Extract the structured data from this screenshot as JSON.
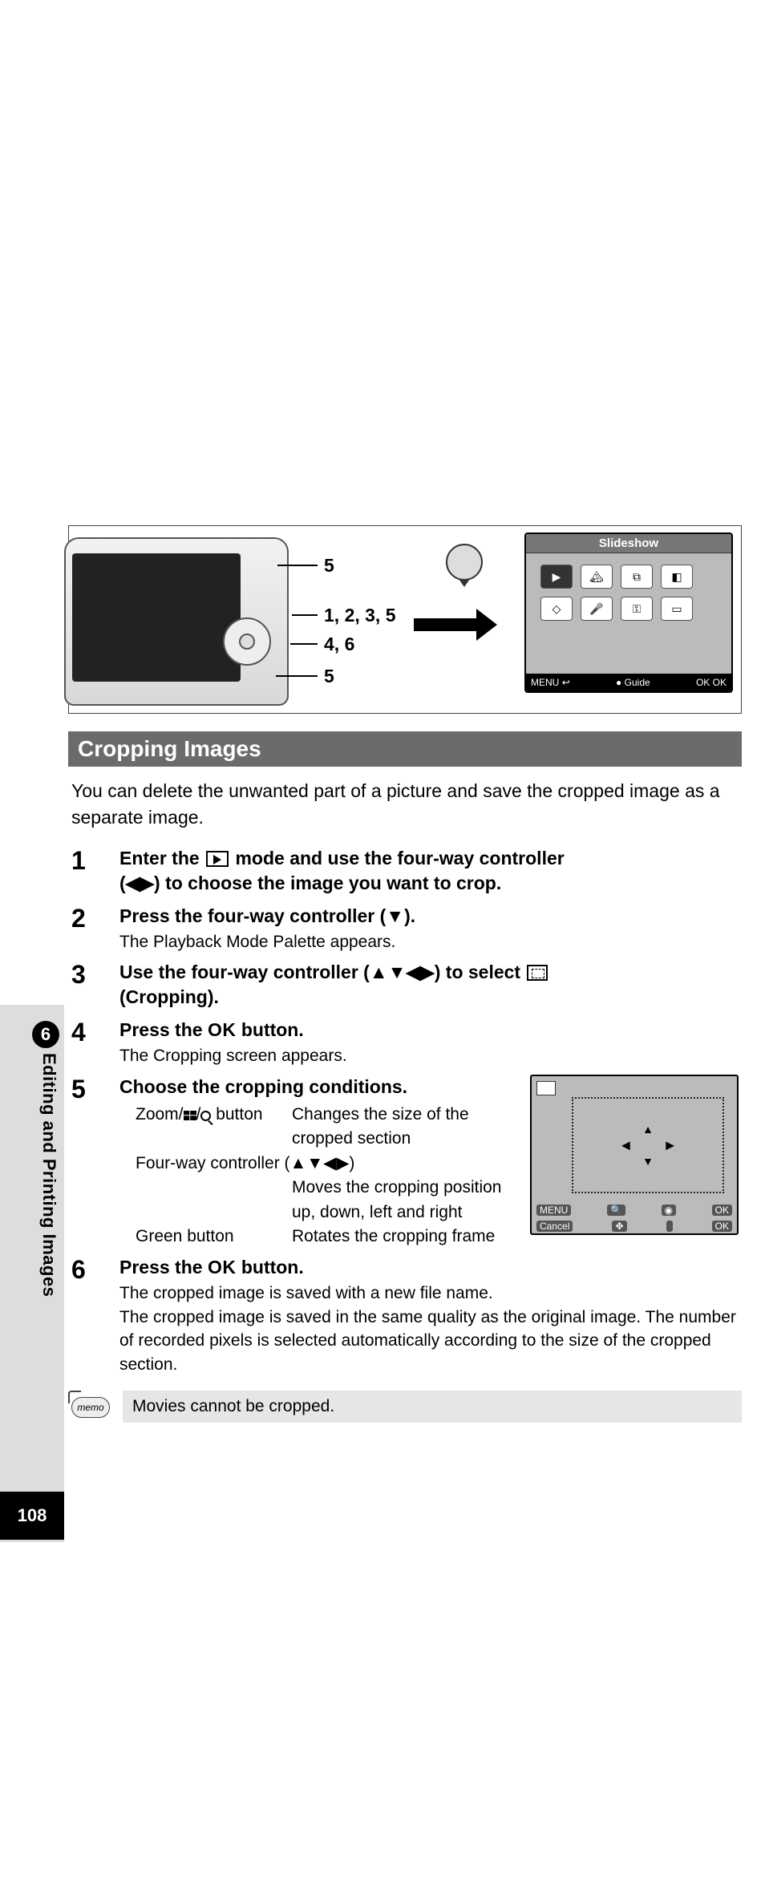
{
  "page_number": "108",
  "side_tab": {
    "chapter": "6",
    "title": "Editing and Printing Images"
  },
  "diagram": {
    "pointers": {
      "a": "5",
      "b": "1, 2, 3, 5",
      "c": "4, 6",
      "d": "5"
    },
    "lcd_title": "Slideshow",
    "lcd_footer": {
      "menu": "MENU",
      "menu_icon": "↩",
      "guide_icon": "●",
      "guide": "Guide",
      "ok": "OK",
      "ok2": "OK"
    }
  },
  "section_title": "Cropping Images",
  "intro": "You can delete the unwanted part of a picture and save the cropped image as a separate image.",
  "steps": {
    "s1": {
      "num": "1",
      "line1_a": "Enter the ",
      "line1_b": " mode and use the four-way controller",
      "line2": "(◀▶) to choose the image you want to crop."
    },
    "s2": {
      "num": "2",
      "head": "Press the four-way controller (▼).",
      "desc": "The Playback Mode Palette appears."
    },
    "s3": {
      "num": "3",
      "head_a": "Use the four-way controller (▲▼◀▶) to select ",
      "head_b": "(Cropping)."
    },
    "s4": {
      "num": "4",
      "head_a": "Press the ",
      "head_ok": "OK",
      "head_b": " button.",
      "desc": "The Cropping screen appears."
    },
    "s5": {
      "num": "5",
      "head": "Choose the cropping conditions.",
      "rows": {
        "r1_lbl_a": "Zoom/",
        "r1_lbl_b": "/",
        "r1_lbl_c": " button",
        "r1_val": "Changes the size of the cropped section",
        "r2_lbl": "Four-way controller (▲▼◀▶)",
        "r2_val": "Moves the cropping position up, down, left and right",
        "r3_lbl": "Green button",
        "r3_val": "Rotates the cropping frame"
      },
      "shot": {
        "menu": "MENU",
        "cancel": "Cancel",
        "zoom_icon": "🔍",
        "move_icon": "✥",
        "green_icon": "◉",
        "ok1": "OK",
        "ok2": "OK"
      }
    },
    "s6": {
      "num": "6",
      "head_a": "Press the ",
      "head_ok": "OK",
      "head_b": " button.",
      "desc": "The cropped image is saved with a new file name.\nThe cropped image is saved in the same quality as the original image. The number of recorded pixels is selected automatically according to the size of the cropped section."
    }
  },
  "memo": {
    "label": "memo",
    "text": "Movies cannot be cropped."
  }
}
